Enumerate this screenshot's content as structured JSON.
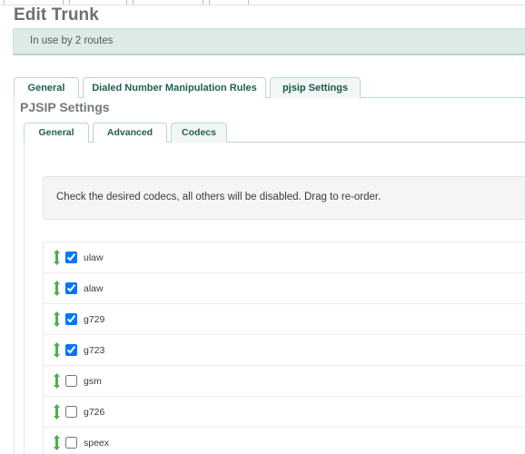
{
  "page": {
    "title": "Edit Trunk"
  },
  "alert": {
    "text": "In use by 2 routes"
  },
  "outer_tabs": [
    {
      "label": "General",
      "active": false
    },
    {
      "label": "Dialed Number Manipulation Rules",
      "active": false
    },
    {
      "label": "pjsip Settings",
      "active": true
    }
  ],
  "section": {
    "heading": "PJSIP Settings"
  },
  "inner_tabs": [
    {
      "label": "General",
      "active": false
    },
    {
      "label": "Advanced",
      "active": false
    },
    {
      "label": "Codecs",
      "active": true
    }
  ],
  "hint": {
    "text": "Check the desired codecs, all others will be disabled. Drag to re-order."
  },
  "codecs": [
    {
      "name": "ulaw",
      "checked": true,
      "handle_icon": "drag-handle-icon"
    },
    {
      "name": "alaw",
      "checked": true,
      "handle_icon": "drag-handle-icon"
    },
    {
      "name": "g729",
      "checked": true,
      "handle_icon": "drag-handle-icon"
    },
    {
      "name": "g723",
      "checked": true,
      "handle_icon": "drag-handle-icon"
    },
    {
      "name": "gsm",
      "checked": false,
      "handle_icon": "drag-handle-icon"
    },
    {
      "name": "g726",
      "checked": false,
      "handle_icon": "drag-handle-icon"
    },
    {
      "name": "speex",
      "checked": false,
      "handle_icon": "drag-handle-icon"
    }
  ],
  "colors": {
    "alert_background": "#dcebe7",
    "alert_border": "#cadfd9",
    "tab_border": "#bcd6cd",
    "tab_text": "#1f5f52",
    "title_text": "#6f6f6f",
    "hint_background": "#f5f5f5",
    "drag_handle": "#4caf50"
  }
}
